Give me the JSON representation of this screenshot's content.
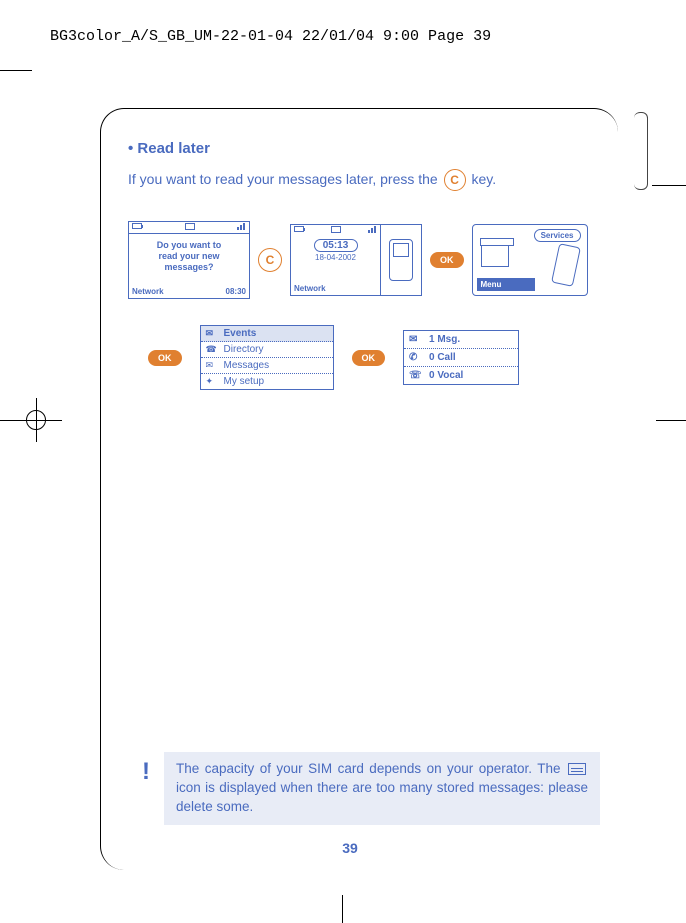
{
  "header_line": "BG3color_A/S_GB_UM-22-01-04  22/01/04  9:00  Page 39",
  "heading": "• Read later",
  "body_before": "If you want to read your messages later, press the ",
  "body_after": " key.",
  "c_key": "C",
  "screen1": {
    "prompt_l1": "Do you want to",
    "prompt_l2": "read your new",
    "prompt_l3": "messages?",
    "network": "Network",
    "time": "08:30"
  },
  "screen2": {
    "time": "05:13",
    "date": "18-04-2002",
    "network": "Network"
  },
  "ok_label": "OK",
  "screen3": {
    "services": "Services",
    "menu": "Menu"
  },
  "menu_items": {
    "events": "Events",
    "directory": "Directory",
    "messages": "Messages",
    "mysetup": "My setup"
  },
  "list_items": {
    "msg": "1 Msg.",
    "call": "0 Call",
    "vocal": "0 Vocal"
  },
  "note_l1": "The capacity of your SIM card depends on your operator.",
  "note_l2a": "The ",
  "note_l2b": " icon is displayed when there are too many stored",
  "note_l3": "messages: please delete some.",
  "page_number": "39"
}
